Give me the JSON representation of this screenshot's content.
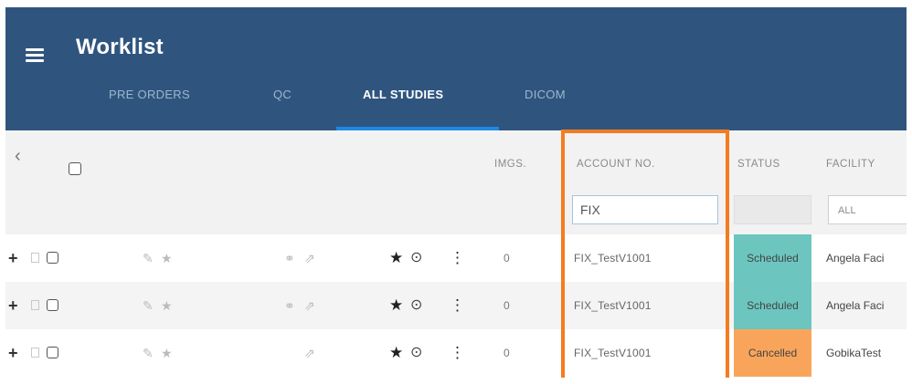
{
  "header": {
    "title": "Worklist",
    "tabs": [
      {
        "label": "PRE ORDERS",
        "active": false
      },
      {
        "label": "QC",
        "active": false
      },
      {
        "label": "ALL STUDIES",
        "active": true
      },
      {
        "label": "DICOM",
        "active": false
      }
    ]
  },
  "columns": {
    "images": "IMGS.",
    "account_no": "ACCOUNT NO.",
    "status": "STATUS",
    "facility": "FACILITY"
  },
  "filters": {
    "account_no_value": "FIX",
    "facility_value": "ALL"
  },
  "rows": [
    {
      "images": "0",
      "account_no": "FIX_TestV1001",
      "status": "Scheduled",
      "status_color": "#6cc6bf",
      "facility": "Angela Faci"
    },
    {
      "images": "0",
      "account_no": "FIX_TestV1001",
      "status": "Scheduled",
      "status_color": "#6cc6bf",
      "facility": "Angela Faci"
    },
    {
      "images": "0",
      "account_no": "FIX_TestV1001",
      "status": "Cancelled",
      "status_color": "#f8a55b",
      "facility": "GobikaTest"
    }
  ],
  "colors": {
    "header_bg": "#2f557f",
    "active_tab_underline": "#1e88e5",
    "highlight_border": "#f47c20"
  },
  "icons": [
    "menu-icon",
    "collapse-chevron-icon",
    "document-icon",
    "edit-pencil-icon",
    "star-outline-icon",
    "link-icon",
    "share-icon",
    "star-filled-icon",
    "clock-icon",
    "more-vertical-icon"
  ]
}
